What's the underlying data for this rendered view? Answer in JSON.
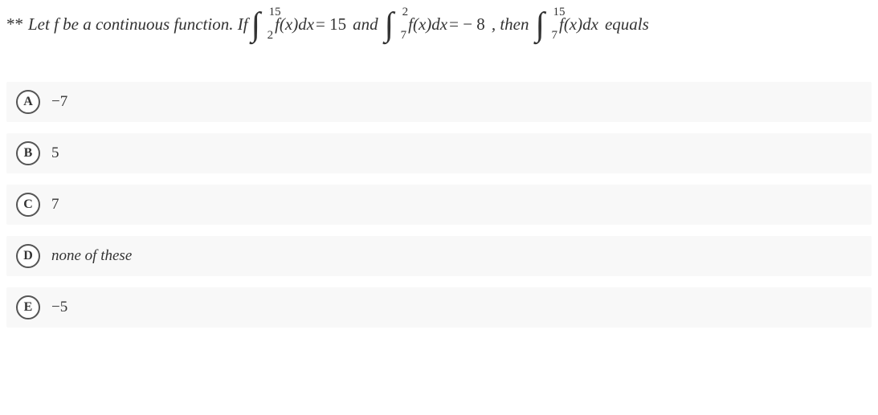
{
  "question": {
    "prefix": "**",
    "t1": "Let f be a continuous function. If",
    "int1": {
      "upper": "15",
      "lower": "2",
      "body": "f(x)dx",
      "equals": "= 15"
    },
    "t2": "and",
    "int2": {
      "upper": "2",
      "lower": "7",
      "body": "f(x)dx",
      "equals": "= − 8"
    },
    "t3": ", then",
    "int3": {
      "upper": "15",
      "lower": "7",
      "body": "f(x)dx"
    },
    "t4": "equals"
  },
  "options": {
    "a": {
      "letter": "A",
      "text": "−7"
    },
    "b": {
      "letter": "B",
      "text": "5"
    },
    "c": {
      "letter": "C",
      "text": "7"
    },
    "d": {
      "letter": "D",
      "text": "none of these"
    },
    "e": {
      "letter": "E",
      "text": "−5"
    }
  }
}
